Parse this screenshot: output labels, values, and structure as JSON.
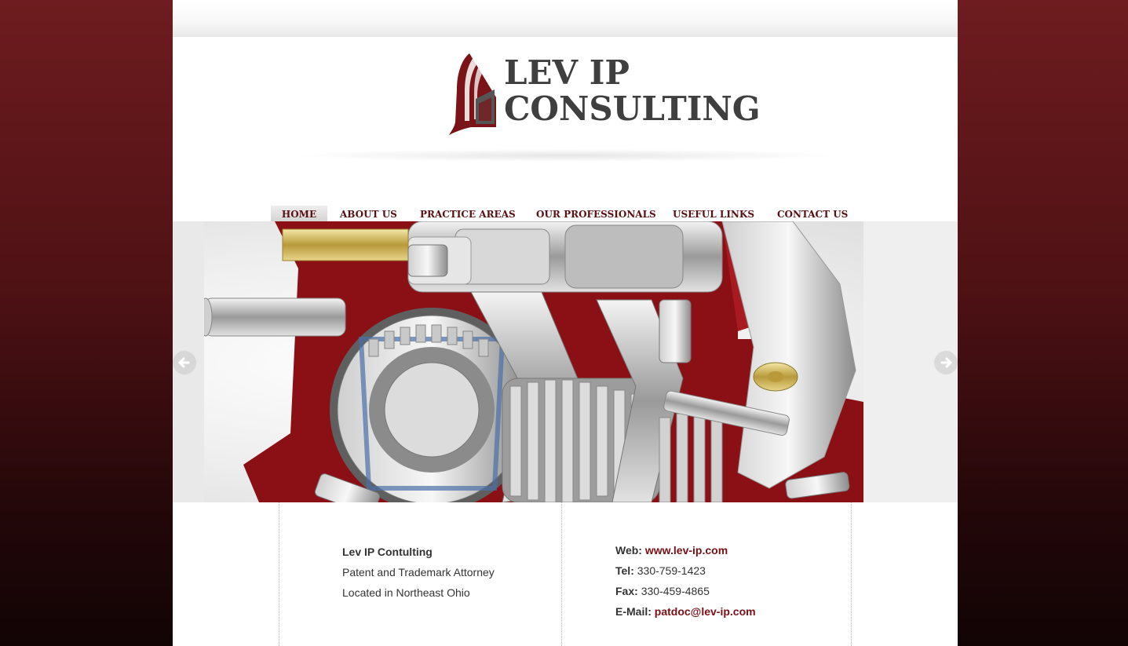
{
  "brand": {
    "logo_line1": "LEV IP",
    "logo_line2": "CONSULTING"
  },
  "nav": {
    "items": [
      {
        "label": "HOME",
        "active": true
      },
      {
        "label": "ABOUT US",
        "active": false
      },
      {
        "label": "PRACTICE AREAS",
        "active": false
      },
      {
        "label": "OUR PROFESSIONALS",
        "active": false
      },
      {
        "label": "USEFUL LINKS",
        "active": false
      },
      {
        "label": "CONTACT US",
        "active": false
      }
    ]
  },
  "slider": {
    "prev_icon": "arrow-left-icon",
    "next_icon": "arrow-right-icon"
  },
  "footer": {
    "company": "Lev IP Contulting",
    "tagline": "Patent and Trademark Attorney",
    "location": "Located in Northeast Ohio",
    "web_label": "Web:",
    "web_value": "www.lev-ip.com",
    "tel_label": "Tel:",
    "tel_value": "330-759-1423",
    "fax_label": "Fax:",
    "fax_value": "330-459-4865",
    "email_label": "E-Mail:",
    "email_value": "patdoc@lev-ip.com"
  },
  "colors": {
    "accent": "#7a0f14",
    "background_top": "#6e1c1f",
    "background_bottom": "#120405",
    "logo_text": "#3f3f3f"
  }
}
